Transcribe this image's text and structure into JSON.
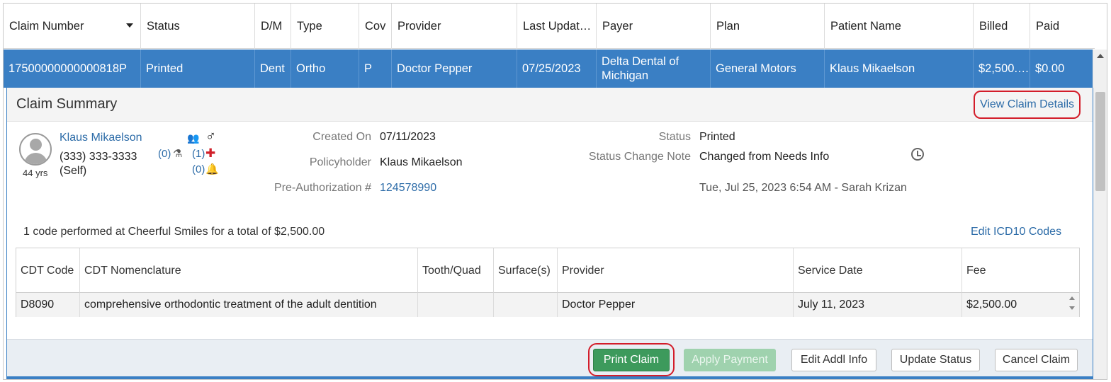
{
  "table_header": {
    "columns": [
      "Claim Number",
      "Status",
      "D/M",
      "Type",
      "Cov",
      "Provider",
      "Last Updat…",
      "Payer",
      "Plan",
      "Patient Name",
      "Billed",
      "Paid"
    ]
  },
  "selected_row": {
    "claim_number": "17500000000000818P",
    "status": "Printed",
    "dm": "Dent",
    "type": "Ortho",
    "cov": "P",
    "provider": "Doctor Pepper",
    "last_updated": "07/25/2023",
    "payer": "Delta Dental of Michigan",
    "plan": "General Motors",
    "patient_name": "Klaus Mikaelson",
    "billed": "$2,500.…",
    "paid": "$0.00"
  },
  "summary": {
    "title": "Claim Summary",
    "view_details_label": "View Claim Details",
    "patient": {
      "name": "Klaus Mikaelson",
      "phone": "(333) 333-3333",
      "relation": "(Self)",
      "age": "44 yrs",
      "lab_count": "(0)",
      "medical_alert_count": "(1)",
      "notification_count": "(0)"
    },
    "details": {
      "created_on_label": "Created On",
      "created_on": "07/11/2023",
      "policyholder_label": "Policyholder",
      "policyholder": "Klaus Mikaelson",
      "preauth_label": "Pre-Authorization #",
      "preauth": "124578990",
      "status_label": "Status",
      "status": "Printed",
      "status_note_label": "Status Change Note",
      "status_note": "Changed from Needs Info",
      "status_timestamp": "Tue, Jul 25, 2023 6:54 AM - Sarah Krizan"
    },
    "codes_summary": "1 code performed at Cheerful Smiles for a total of $2,500.00",
    "edit_icd_label": "Edit ICD10 Codes"
  },
  "codes_table": {
    "headers": [
      "CDT Code",
      "CDT Nomenclature",
      "Tooth/Quad",
      "Surface(s)",
      "Provider",
      "Service Date",
      "Fee"
    ],
    "rows": [
      {
        "code": "D8090",
        "nomenclature": "comprehensive orthodontic treatment of the adult dentition",
        "tooth": "",
        "surfaces": "",
        "provider": "Doctor Pepper",
        "service_date": "July 11, 2023",
        "fee": "$2,500.00"
      }
    ]
  },
  "footer": {
    "print_claim": "Print Claim",
    "apply_payment": "Apply Payment",
    "edit_addl_info": "Edit Addl Info",
    "update_status": "Update Status",
    "cancel_claim": "Cancel Claim"
  },
  "colors": {
    "selected_row": "#3a7fc4",
    "link": "#2d6ca8",
    "highlight_ring": "#d31d2a",
    "primary_button": "#3d9a5c",
    "alert_red": "#d0202a"
  }
}
